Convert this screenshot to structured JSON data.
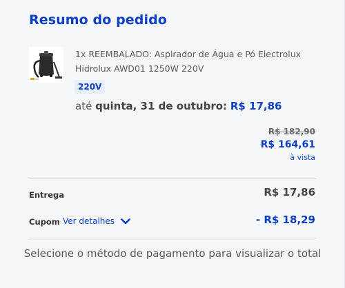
{
  "summary": {
    "title": "Resumo do pedido"
  },
  "product": {
    "name": "1x REEMBALADO: Aspirador de Água e Pó Electrolux Hidrolux AWD01 1250W 220V",
    "variant": "220V",
    "image_icon": "vacuum-cleaner-icon",
    "delivery_prefix": "até",
    "delivery_date": "quinta, 31 de outubro:",
    "delivery_price": "R$ 17,86",
    "old_price": "R$ 182,90",
    "new_price": "R$ 164,61",
    "price_note": "à vista"
  },
  "totals": {
    "delivery_label": "Entrega",
    "delivery_value": "R$ 17,86",
    "coupon_label": "Cupom",
    "coupon_link": "Ver detalhes",
    "coupon_value": "- R$ 18,29"
  },
  "footer": {
    "note": "Selecione o método de pagamento para visualizar o total"
  },
  "colors": {
    "accent": "#0b3fc6",
    "text": "#4a4a4a",
    "background": "#f5f6f8"
  }
}
